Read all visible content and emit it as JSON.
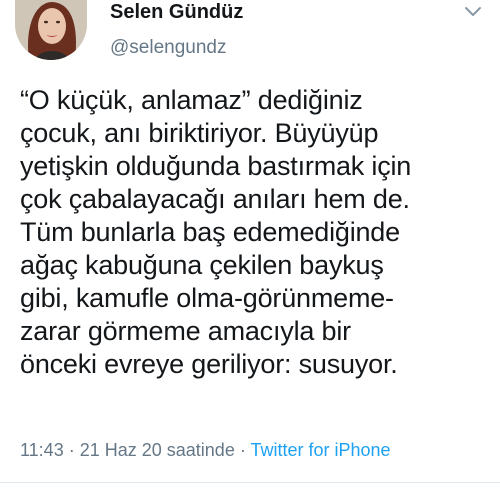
{
  "user": {
    "display_name": "Selen Gündüz",
    "handle": "@selengundz",
    "avatar_icon": "profile-photo"
  },
  "menu": {
    "icon": "chevron-down-icon"
  },
  "tweet": {
    "lines": [
      "“O küçük, anlamaz” dediğiniz",
      "çocuk, anı biriktiriyor. Büyüyüp",
      "yetişkin olduğunda bastırmak için",
      "çok çabalayacağı anıları hem de.",
      "Tüm bunlarla baş edemediğinde",
      "ağaç kabuğuna çekilen baykuş",
      "gibi, kamufle olma-görünmeme-",
      "zarar görmeme amacıyla bir",
      "önceki evreye geriliyor: susuyor."
    ]
  },
  "meta": {
    "time": "11:43",
    "sep1": " · ",
    "date": "21 Haz 20 saatinde",
    "sep2": " · ",
    "source": "Twitter for iPhone"
  },
  "colors": {
    "text": "#14171a",
    "secondary": "#657786",
    "link": "#1da1f2"
  }
}
